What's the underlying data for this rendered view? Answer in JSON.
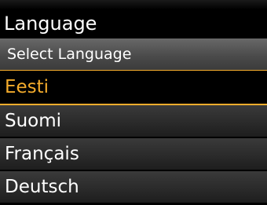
{
  "screen": {
    "title": "Language",
    "header": "Select Language",
    "selected_index": 0,
    "colors": {
      "background": "#000000",
      "text": "#ffffff",
      "highlight": "#f4ac2c",
      "header_bar": "#555555"
    },
    "items": [
      {
        "label": "Eesti"
      },
      {
        "label": "Suomi"
      },
      {
        "label": "Français"
      },
      {
        "label": "Deutsch"
      }
    ]
  }
}
